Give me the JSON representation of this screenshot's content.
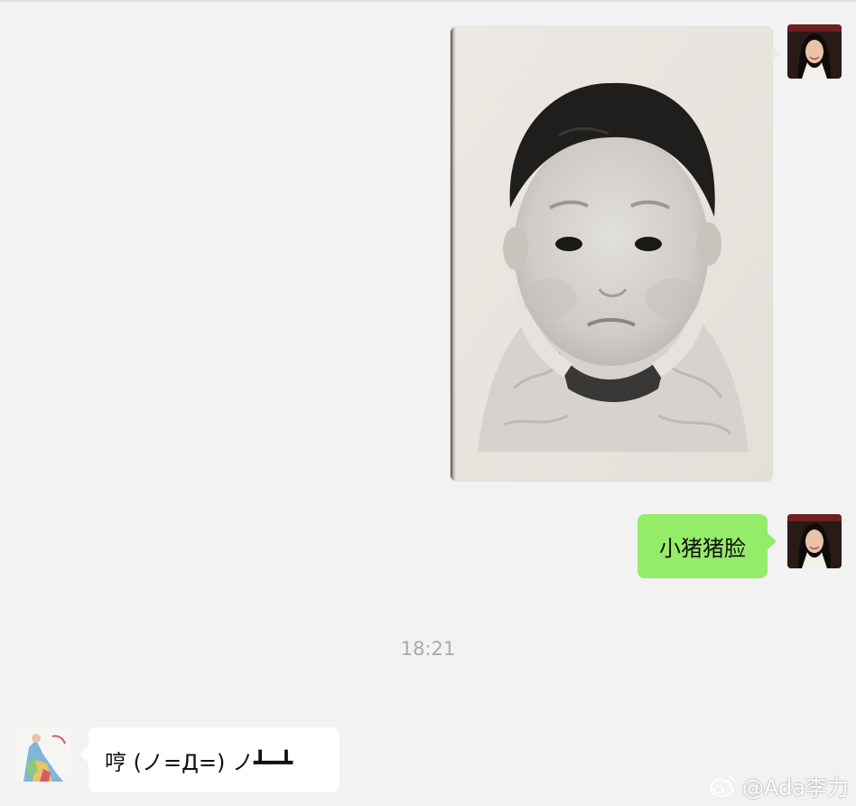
{
  "conversation": {
    "messages": [
      {
        "side": "right",
        "type": "image",
        "image_name": "baby-passport-photo"
      },
      {
        "side": "right",
        "type": "text",
        "text": "小猪猪脸"
      },
      {
        "side": "left",
        "type": "text",
        "text": "哼 (ノ=Д=) ノ┻━┻"
      }
    ],
    "timestamp": "18:21"
  },
  "watermark": {
    "icon": "weibo-icon",
    "text": "@Ada李力"
  },
  "colors": {
    "background": "#f2f2f2",
    "sent_bubble": "#95ec69",
    "received_bubble": "#ffffff",
    "timestamp_text": "#aaaaaa"
  }
}
